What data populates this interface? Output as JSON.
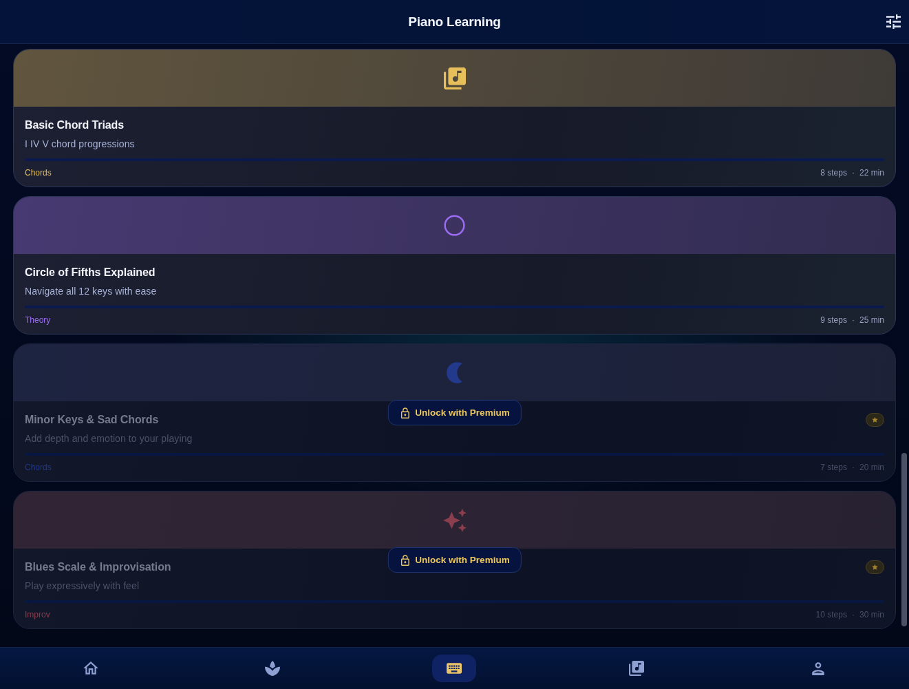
{
  "header": {
    "title": "Piano Learning"
  },
  "lessons": [
    {
      "title": "Basic Chord Triads",
      "subtitle": "I IV V chord progressions",
      "category": "Chords",
      "color": "#e6be5a",
      "level": 0,
      "steps": "8 steps",
      "separator": "·",
      "duration": "22 min",
      "locked": false
    },
    {
      "title": "Circle of Fifths Explained",
      "subtitle": "Navigate all 12 keys with ease",
      "category": "Theory",
      "color": "#9b6cf2",
      "level": 0,
      "steps": "9 steps",
      "separator": "·",
      "duration": "25 min",
      "locked": false
    },
    {
      "title": "Minor Keys & Sad Chords",
      "subtitle": "Add depth and emotion to your playing",
      "category": "Chords",
      "color": "#22398c",
      "level": 0,
      "steps": "7 steps",
      "separator": "·",
      "duration": "20 min",
      "locked": true,
      "unlock_label": "Unlock with Premium"
    },
    {
      "title": "Blues Scale & Improvisation",
      "subtitle": "Play expressively with feel",
      "category": "Improv",
      "color": "#8a3e4e",
      "level": 0,
      "steps": "10 steps",
      "separator": "·",
      "duration": "30 min",
      "locked": true,
      "unlock_label": "Unlock with Premium"
    }
  ],
  "nav": [
    {
      "selected": false
    },
    {
      "selected": false
    },
    {
      "selected": true
    },
    {
      "selected": false
    },
    {
      "selected": false
    }
  ]
}
